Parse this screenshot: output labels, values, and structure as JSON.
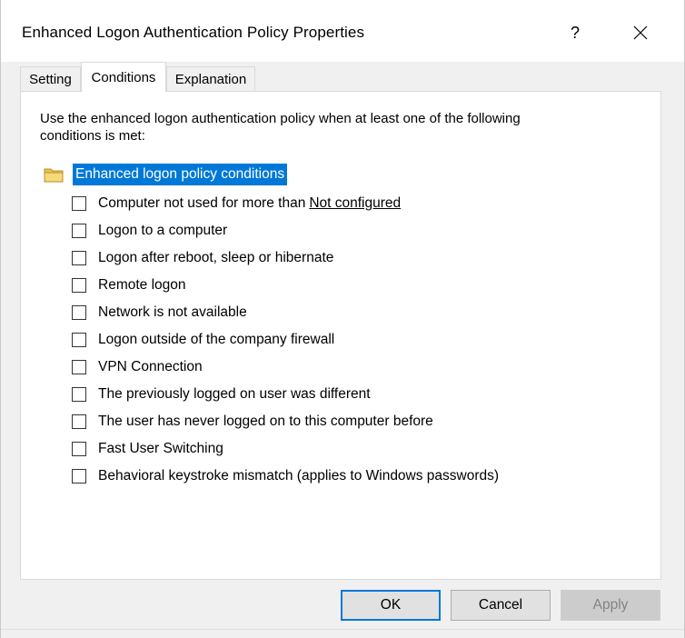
{
  "window": {
    "title": "Enhanced Logon Authentication Policy Properties",
    "help_glyph": "?",
    "close_glyph": "✕"
  },
  "tabs": [
    {
      "label": "Setting",
      "active": false
    },
    {
      "label": "Conditions",
      "active": true
    },
    {
      "label": "Explanation",
      "active": false
    }
  ],
  "panel": {
    "description": "Use the enhanced logon authentication policy when at least one of the following conditions is met:",
    "tree_root_label": "Enhanced logon policy conditions",
    "conditions": [
      {
        "label": "Computer not used for more than",
        "link": "Not configured",
        "checked": false
      },
      {
        "label": "Logon to a computer",
        "checked": false
      },
      {
        "label": "Logon after reboot, sleep or hibernate",
        "checked": false
      },
      {
        "label": "Remote logon",
        "checked": false
      },
      {
        "label": "Network is not available",
        "checked": false
      },
      {
        "label": "Logon outside of the company firewall",
        "checked": false
      },
      {
        "label": "VPN Connection",
        "checked": false
      },
      {
        "label": "The previously logged on user was different",
        "checked": false
      },
      {
        "label": "The user has never logged on to this computer before",
        "checked": false
      },
      {
        "label": "Fast User Switching",
        "checked": false
      },
      {
        "label": "Behavioral keystroke mismatch (applies to Windows passwords)",
        "checked": false
      }
    ]
  },
  "buttons": {
    "ok": "OK",
    "cancel": "Cancel",
    "apply": "Apply"
  },
  "colors": {
    "selection": "#0078d7",
    "folder": "#e8c34f"
  }
}
